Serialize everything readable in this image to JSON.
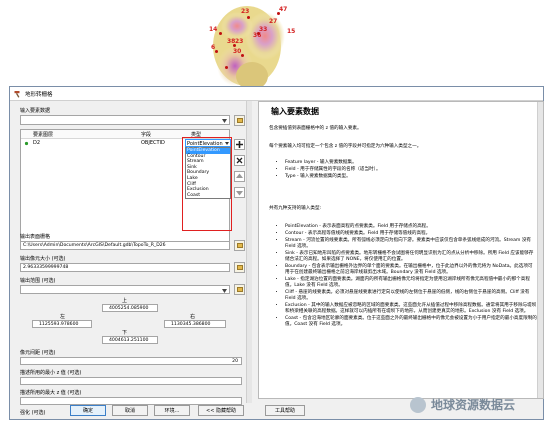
{
  "map_labels": [
    "23",
    "47",
    "27",
    "14",
    "33",
    "15",
    "36",
    "38",
    "23",
    "6",
    "30"
  ],
  "window": {
    "title": "地形转栅格"
  },
  "input_features": {
    "label": "输入要素数据",
    "headers": {
      "layer": "要素图层",
      "field": "字段",
      "type": "类型"
    },
    "row": {
      "layer": "D2",
      "field": "OBJECTID",
      "type": "PointElevation"
    }
  },
  "type_options": [
    "PointElevation",
    "Contour",
    "Stream",
    "Sink",
    "Boundary",
    "Lake",
    "Cliff",
    "Exclusion",
    "Coast"
  ],
  "output_raster": {
    "label": "输出表面栅格",
    "value": "C:\\Users\\Admin\\Documents\\ArcGIS\\Default.gdb\\TopoTo_R_D26"
  },
  "cell_size": {
    "label": "输出像元大小 (可选)",
    "value": "2.96333599999748"
  },
  "output_extent": {
    "label": "输出范围 (可选)",
    "top_label": "上",
    "top_value": "4005254.085900",
    "left_label": "左",
    "left_value": "1125593.978600",
    "right_label": "右",
    "right_value": "1130345.386800",
    "bottom_label": "下",
    "bottom_value": "4004613.251100"
  },
  "margin": {
    "label": "像元间距 (可选)",
    "value": "20"
  },
  "min_z": {
    "label": "描述所用的最小 z 值 (可选)"
  },
  "max_z": {
    "label": "描述所用的最大 z 值 (可选)"
  },
  "enforce": {
    "label": "强化 (可选)"
  },
  "buttons": {
    "ok": "确定",
    "cancel": "取消",
    "env": "环境...",
    "hide_help": "<< 隐藏帮助",
    "tool_help": "工具帮助"
  },
  "help": {
    "title": "输入要素数据",
    "intro": "包含要插值到表面栅格中的 z 值的输入要素。",
    "p1": "每个要素输入均可指定一个包含 z 值的字段并可指定为六种输入类型之一。",
    "fields": [
      "Feature layer - 输入要素数据集。",
      "Field - 用于存储属性的字段的名称（适当时）。",
      "Type - 输入要素数据集的类型。"
    ],
    "p2": "共有九种支持的输入类型:",
    "types": [
      "PointElevation - 表示表面高程的点要素类。Field 用于存储点的高程。",
      "Contour - 表示高程等值线的线要素类。Field 用于存储等值线的高程。",
      "Stream - 河流位置的线要素类。所有弧线必须定向为指向下游。要素类中应该仅包含单条弧线组成的河流。Stream 没有 Field 选项。",
      "Sink - 表示已知地形凹陷的点要素类。地形转栅格不会试图将任何明显识别为汇的点从分析中移除。所用 Field 应该能够存储合法汇的高程。如果选择了 NONE，将仅使用汇的位置。",
      "Boundary - 包含表示输出栅格外边界的单个面的要素类。在输出栅格中，位于此边界以外的像元将为 NoData。此选项可用于在创建最终输出栅格之前沿海岸线裁剪出水域。Boundary 没有 Field 选项。",
      "Lake - 指定湖泊位置的面要素类。湖面内的所有输出栅格像元均将指定为使用沿湖岸线所有像元高程值中最小的那个高程值。Lake 没有 Field 选项。",
      "Cliff - 悬崖的线要素类。必须对悬崖线要素进行定向以使线的左侧位于悬崖的低侧，线的右侧位于悬崖的高侧。Cliff 没有 Field 选项。",
      "Exclusion - 其中的输入数据应被忽略的区域的面要素类。这些面允许从插值过程中移除高程数据。通常将其用于移除与堤坝和桥梁相关联的高程数据。这样就可以内插所有在堤坝下的地形，从而创建更真实的地形。Exclusion 没有 Field 选项。",
      "Coast - 包含沿海地区轮廓的面要素类。位于这些面之外的最终输出栅格中的像元会被设置为小于用户指定的最小高度限制的值。Coast 没有 Field 选项。"
    ]
  },
  "watermark": "地球资源数据云",
  "colors": {
    "selection": "#3399ff",
    "highlight_frame": "#e02020",
    "map_label": "#d42020"
  }
}
